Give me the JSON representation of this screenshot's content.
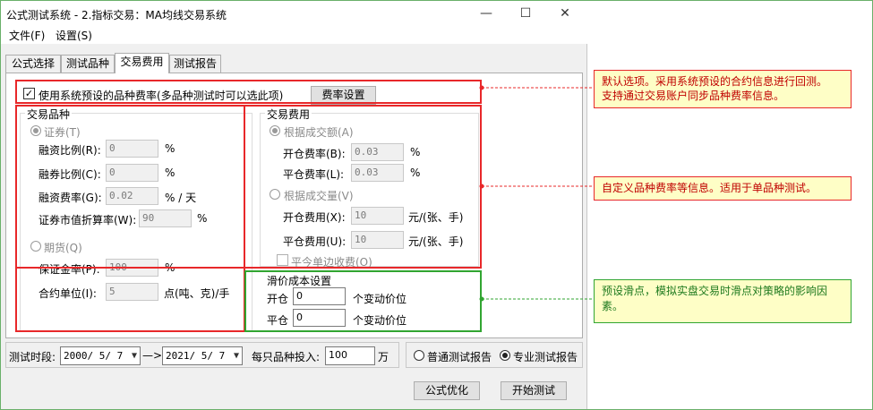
{
  "window": {
    "title": "公式测试系统 - 2.指标交易：MA均线交易系统",
    "controls": {
      "minimize": "—",
      "maximize": "☐",
      "close": "✕"
    }
  },
  "menu": {
    "file": "文件(F)",
    "settings": "设置(S)"
  },
  "tabs": [
    {
      "label": "公式选择",
      "active": false
    },
    {
      "label": "测试品种",
      "active": false
    },
    {
      "label": "交易费用",
      "active": true
    },
    {
      "label": "测试报告",
      "active": false
    }
  ],
  "preset": {
    "checked": true,
    "check_mark": "✓",
    "label": "使用系统预设的品种费率(多品种测试时可以选此项)",
    "button": "费率设置"
  },
  "variety": {
    "title": "交易品种",
    "securities": {
      "label": "证券(T)",
      "selected": true
    },
    "margin_ratio": {
      "label": "融资比例(R):",
      "value": "0",
      "unit": "%"
    },
    "short_ratio": {
      "label": "融券比例(C):",
      "value": "0",
      "unit": "%"
    },
    "fin_rate": {
      "label": "融资费率(G):",
      "value": "0.02",
      "unit": "% / 天"
    },
    "discount": {
      "label": "证券市值折算率(W):",
      "value": "90",
      "unit": "%"
    },
    "futures": {
      "label": "期货(Q)",
      "selected": false
    },
    "deposit": {
      "label": "保证金率(P):",
      "value": "100",
      "unit": "%"
    },
    "contract_unit": {
      "label": "合约单位(I):",
      "value": "5",
      "unit": "点(吨、克)/手"
    }
  },
  "fees": {
    "title": "交易费用",
    "by_amount": {
      "label": "根据成交额(A)",
      "selected": true
    },
    "open_rate": {
      "label": "开仓费率(B):",
      "value": "0.03",
      "unit": "%"
    },
    "close_rate": {
      "label": "平仓费率(L):",
      "value": "0.03",
      "unit": "%"
    },
    "by_volume": {
      "label": "根据成交量(V)",
      "selected": false
    },
    "open_fee": {
      "label": "开仓费用(X):",
      "value": "10",
      "unit": "元/(张、手)"
    },
    "close_fee": {
      "label": "平仓费用(U):",
      "value": "10",
      "unit": "元/(张、手)"
    },
    "close_today": {
      "label": "平今单边收费(O)",
      "checked": false
    }
  },
  "slippage": {
    "title": "滑价成本设置",
    "open": {
      "label": "开仓",
      "value": "0",
      "unit": "个变动价位"
    },
    "close": {
      "label": "平仓",
      "value": "0",
      "unit": "个变动价位"
    }
  },
  "bottom": {
    "period_label": "测试时段:",
    "start_date": "2000/ 5/ 7",
    "arrow": "—>",
    "end_date": "2021/ 5/ 7",
    "invest_label": "每只品种投入:",
    "invest_value": "100",
    "invest_unit": "万",
    "report_normal": {
      "label": "普通测试报告",
      "selected": false
    },
    "report_pro": {
      "label": "专业测试报告",
      "selected": true
    },
    "optimize_button": "公式优化",
    "start_button": "开始测试"
  },
  "annotations": {
    "note1_line1": "默认选项。采用系统预设的合约信息进行回测。",
    "note1_line2": "支持通过交易账户同步品种费率信息。",
    "note2": "自定义品种费率等信息。适用于单品种测试。",
    "note3_line1": "预设滑点，模拟实盘交易时滑点对策略的影响因",
    "note3_line2": "素。",
    "red_color": "#e8282a",
    "green_color": "#31a531",
    "note_bg": "#fefec6"
  }
}
